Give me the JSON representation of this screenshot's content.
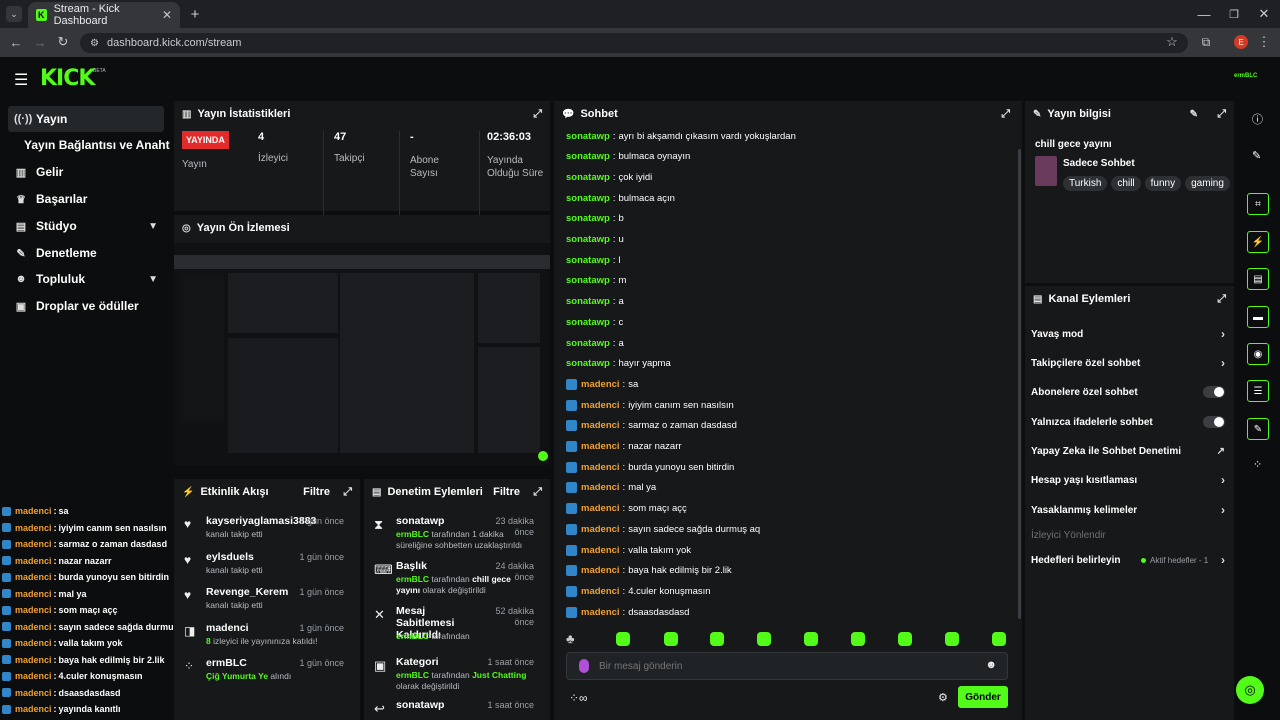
{
  "browser": {
    "tab_title": "Stream - Kick Dashboard",
    "url": "dashboard.kick.com/stream",
    "profile_initial": "E"
  },
  "app": {
    "logo": "KICK",
    "beta": "BETA",
    "user": "ermBLC"
  },
  "sidebar": {
    "items": [
      {
        "label": "Yayın",
        "icon": "broadcast-icon"
      },
      {
        "label": "Yayın Bağlantısı ve Anahtarı",
        "icon": ""
      },
      {
        "label": "Gelir",
        "icon": "chart-icon"
      },
      {
        "label": "Başarılar",
        "icon": "trophy-icon"
      },
      {
        "label": "Stüdyo",
        "icon": "studio-icon"
      },
      {
        "label": "Denetleme",
        "icon": "wrench-icon"
      },
      {
        "label": "Topluluk",
        "icon": "community-icon"
      },
      {
        "label": "Droplar ve ödüller",
        "icon": "gift-icon"
      }
    ]
  },
  "stats": {
    "title": "Yayın İstatistikleri",
    "live_label": "YAYINDA",
    "status_label": "Yayın",
    "viewers": "4",
    "viewers_label": "İzleyici",
    "followers": "47",
    "followers_label": "Takipçi",
    "subs": "-",
    "subs_label": "Abone Sayısı",
    "uptime": "02:36:03",
    "uptime_label": "Yayında Olduğu Süre"
  },
  "preview": {
    "title": "Yayın Ön İzlemesi"
  },
  "activity": {
    "title": "Etkinlik Akışı",
    "filter": "Filtre",
    "items": [
      {
        "name": "kayseriyaglamasi3883",
        "time": "1 gün önce",
        "sub": "kanalı takip etti"
      },
      {
        "name": "eylsduels",
        "time": "1 gün önce",
        "sub": "kanalı takip etti"
      },
      {
        "name": "Revenge_Kerem",
        "time": "1 gün önce",
        "sub": "kanalı takip etti"
      },
      {
        "name": "madenci",
        "time": "1 gün önce",
        "sub_hl": "8",
        "sub": " izleyici ile yayınınıza katıldı!"
      },
      {
        "name": "ermBLC",
        "time": "1 gün önce",
        "sub_hl": "Çiğ Yumurta Ye",
        "sub": " alındı"
      }
    ]
  },
  "moderation": {
    "title": "Denetim Eylemleri",
    "filter": "Filtre",
    "items": [
      {
        "name": "sonatawp",
        "time": "23 dakika önce",
        "who": "ermBLC",
        "sub": " tarafından 1 dakika süreliğine sohbetten uzaklaştırıldı"
      },
      {
        "name": "Başlık",
        "time": "24 dakika önce",
        "who": "ermBLC",
        "sub": " tarafından ",
        "hl2": "chill gece yayını",
        "sub2": " olarak değiştirildi"
      },
      {
        "name": "Mesaj Sabitlemesi Kaldırıldı",
        "time": "52 dakika önce",
        "who": "ermBLC",
        "sub": " tarafından"
      },
      {
        "name": "Kategori",
        "time": "1 saat önce",
        "who": "ermBLC",
        "sub": " tarafından ",
        "hl2": "Just Chatting",
        "sub2": " olarak değiştirildi"
      },
      {
        "name": "sonatawp",
        "time": "1 saat önce",
        "who": "",
        "sub": ""
      }
    ]
  },
  "chat": {
    "title": "Sohbet",
    "placeholder": "Bir mesaj gönderin",
    "send": "Gönder",
    "messages": [
      {
        "user": "sonatawp",
        "text": "ayrı bi akşamdı çıkasım vardı yokuşlardan",
        "badge": false
      },
      {
        "user": "sonatawp",
        "text": "bulmaca oynayın",
        "badge": false
      },
      {
        "user": "sonatawp",
        "text": "çok iyidi",
        "badge": false
      },
      {
        "user": "sonatawp",
        "text": "bulmaca açın",
        "badge": false
      },
      {
        "user": "sonatawp",
        "text": "b",
        "badge": false
      },
      {
        "user": "sonatawp",
        "text": "u",
        "badge": false
      },
      {
        "user": "sonatawp",
        "text": "l",
        "badge": false
      },
      {
        "user": "sonatawp",
        "text": "m",
        "badge": false
      },
      {
        "user": "sonatawp",
        "text": "a",
        "badge": false
      },
      {
        "user": "sonatawp",
        "text": "c",
        "badge": false
      },
      {
        "user": "sonatawp",
        "text": "a",
        "badge": false
      },
      {
        "user": "sonatawp",
        "text": "hayır yapma",
        "badge": false
      },
      {
        "user": "madenci",
        "text": "sa",
        "badge": true
      },
      {
        "user": "madenci",
        "text": "iyiyim canım sen nasılsın",
        "badge": true
      },
      {
        "user": "madenci",
        "text": "sarmaz o zaman dasdasd",
        "badge": true
      },
      {
        "user": "madenci",
        "text": "nazar nazarr",
        "badge": true
      },
      {
        "user": "madenci",
        "text": "burda yunoyu sen bitirdin",
        "badge": true
      },
      {
        "user": "madenci",
        "text": "mal ya",
        "badge": true
      },
      {
        "user": "madenci",
        "text": "som maçı açç",
        "badge": true
      },
      {
        "user": "madenci",
        "text": "sayın sadece sağda durmuş aq",
        "badge": true
      },
      {
        "user": "madenci",
        "text": "valla takım yok",
        "badge": true
      },
      {
        "user": "madenci",
        "text": "baya hak edilmiş bir 2.lik",
        "badge": true
      },
      {
        "user": "madenci",
        "text": "4.culer konuşmasın",
        "badge": true
      },
      {
        "user": "madenci",
        "text": "dsaasdasdasd",
        "badge": true
      }
    ]
  },
  "overlay_chat": [
    {
      "user": "madenci",
      "text": "sa"
    },
    {
      "user": "madenci",
      "text": "iyiyim canım sen nasılsın"
    },
    {
      "user": "madenci",
      "text": "sarmaz o zaman dasdasd"
    },
    {
      "user": "madenci",
      "text": "nazar nazarr"
    },
    {
      "user": "madenci",
      "text": "burda yunoyu sen bitirdin"
    },
    {
      "user": "madenci",
      "text": "mal ya"
    },
    {
      "user": "madenci",
      "text": "som maçı açç"
    },
    {
      "user": "madenci",
      "text": "sayın sadece sağda durmuş aq"
    },
    {
      "user": "madenci",
      "text": "valla takım yok"
    },
    {
      "user": "madenci",
      "text": "baya hak edilmiş bir 2.lik"
    },
    {
      "user": "madenci",
      "text": "4.culer konuşmasın"
    },
    {
      "user": "madenci",
      "text": "dsaasdasdasd"
    },
    {
      "user": "madenci",
      "text": "yayında kanıtlı"
    }
  ],
  "stream_info": {
    "title": "Yayın bilgisi",
    "stream_title": "chill gece yayını",
    "category": "Sadece Sohbet",
    "tags": [
      "Turkish",
      "chill",
      "funny",
      "gaming"
    ]
  },
  "channel_actions": {
    "title": "Kanal Eylemleri",
    "slow_mode": "Yavaş mod",
    "followers_only": "Takipçilere özel sohbet",
    "subs_only": "Abonelere özel sohbet",
    "emotes_only": "Yalnızca ifadelerle sohbet",
    "ai_moderation": "Yapay Zeka ile Sohbet Denetimi",
    "account_age": "Hesap yaşı kısıtlaması",
    "banned_words": "Yasaklanmış kelimeler",
    "viewer_redirect": "İzleyici Yönlendir",
    "goals": "Hedefleri belirleyin",
    "goals_status": "Aktif hedefler - 1"
  },
  "colors": {
    "accent": "#53fc18",
    "live": "#e32b2b",
    "panel": "#16181a",
    "moderator_name": "#f0a030"
  }
}
